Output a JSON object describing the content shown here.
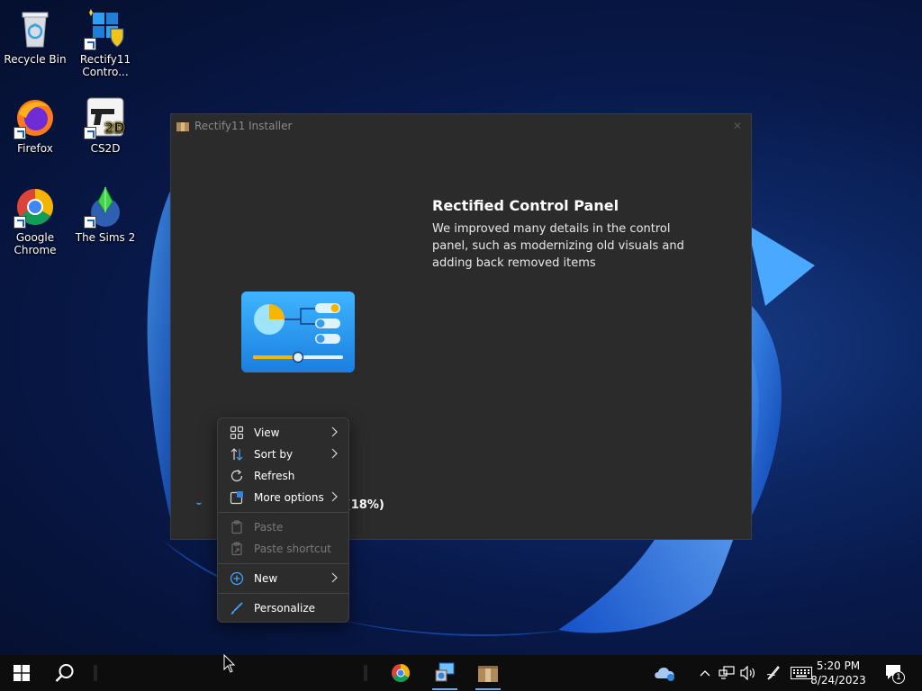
{
  "desktop": {
    "icons": [
      {
        "label": "Recycle Bin",
        "icon": "recycle-bin-icon"
      },
      {
        "label": "Rectify11 Contro...",
        "icon": "control-panel-shortcut-icon"
      },
      {
        "label": "Firefox",
        "icon": "firefox-icon"
      },
      {
        "label": "CS2D",
        "icon": "cs2d-icon"
      },
      {
        "label": "Google Chrome",
        "icon": "chrome-icon"
      },
      {
        "label": "The Sims 2",
        "icon": "sims-icon"
      }
    ]
  },
  "installer": {
    "title": "Rectify11 Installer",
    "feature_title": "Rectified Control Panel",
    "feature_description": "We improved many details in the control panel, such as modernizing old visuals and adding back removed items",
    "status_visible": "n (18%)"
  },
  "context_menu": {
    "items": [
      {
        "label": "View",
        "icon": "grid-icon",
        "submenu": true,
        "enabled": true
      },
      {
        "label": "Sort by",
        "icon": "sort-icon",
        "submenu": true,
        "enabled": true
      },
      {
        "label": "Refresh",
        "icon": "refresh-icon",
        "submenu": false,
        "enabled": true
      },
      {
        "label": "More options",
        "icon": "more-options-icon",
        "submenu": true,
        "enabled": true
      },
      {
        "label": "Paste",
        "icon": "paste-icon",
        "submenu": false,
        "enabled": false
      },
      {
        "label": "Paste shortcut",
        "icon": "paste-shortcut-icon",
        "submenu": false,
        "enabled": false
      },
      {
        "label": "New",
        "icon": "new-icon",
        "submenu": true,
        "enabled": true
      },
      {
        "label": "Personalize",
        "icon": "brush-icon",
        "submenu": false,
        "enabled": true
      }
    ]
  },
  "taskbar": {
    "time": "5:20 PM",
    "date": "8/24/2023",
    "notification_count": "1"
  },
  "colors": {
    "accent": "#3a8ee6",
    "window_bg": "#2b2b2b",
    "menu_bg": "#2c2c2c",
    "taskbar_bg": "#0d0d0d"
  }
}
